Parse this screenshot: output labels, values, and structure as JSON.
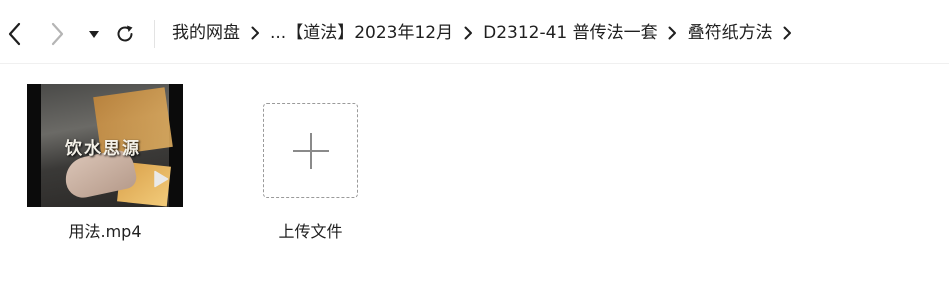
{
  "toolbar": {
    "back_icon": "chevron-left-icon",
    "forward_icon": "chevron-right-icon",
    "history_icon": "caret-down-icon",
    "refresh_icon": "refresh-icon"
  },
  "breadcrumb": {
    "items": [
      {
        "label": "我的网盘"
      },
      {
        "label": "..."
      },
      {
        "label": "【道法】2023年12月"
      },
      {
        "label": "D2312-41 普传法一套"
      },
      {
        "label": "叠符纸方法"
      }
    ],
    "separator_icon": "chevron-right-icon"
  },
  "files": [
    {
      "name": "用法.mp4",
      "type": "video",
      "thumbnail_caption": "饮水思源"
    }
  ],
  "upload": {
    "label": "上传文件",
    "icon": "plus-icon"
  },
  "colors": {
    "text": "#1f1f1f",
    "disabled": "#b5b5b5",
    "dashed_border": "#9a9a9a",
    "plus": "#8a8a8a"
  }
}
